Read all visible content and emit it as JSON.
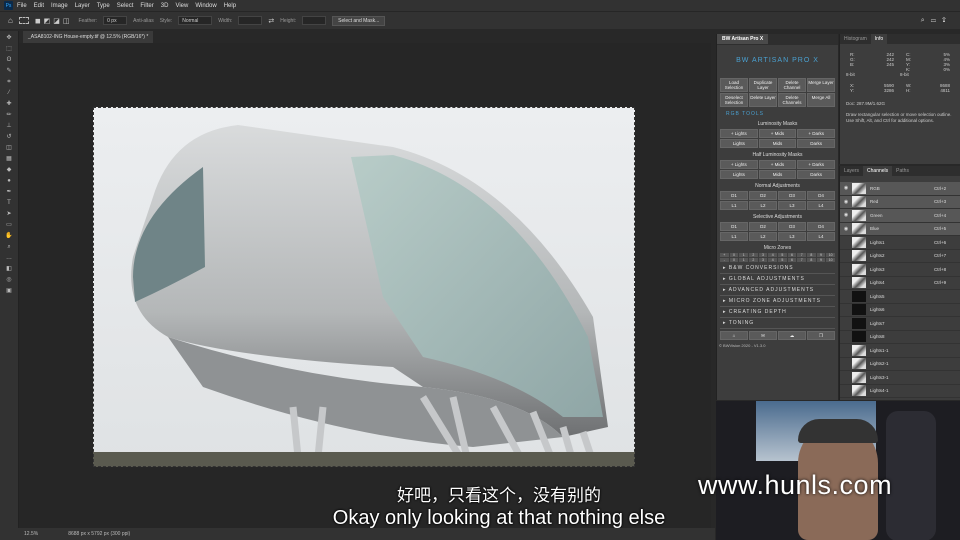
{
  "menubar": {
    "app_icon": "ps-logo",
    "items": [
      "File",
      "Edit",
      "Image",
      "Layer",
      "Type",
      "Select",
      "Filter",
      "3D",
      "View",
      "Window",
      "Help"
    ]
  },
  "options": {
    "feather_label": "Feather:",
    "feather_value": "0 px",
    "antialias": "Anti-alias",
    "style_label": "Style:",
    "style_value": "Normal",
    "width_label": "Width:",
    "height_label": "Height:",
    "select_mask": "Select and Mask..."
  },
  "document": {
    "tab": "_ASA8102-ING House-empty.tif @ 12.5% (RGB/16*) *",
    "zoom": "12.5%",
    "dims": "8688 px x 5792 px (300 ppi)"
  },
  "subtitles": {
    "zh": "好吧，只看这个，没有别的",
    "en": "Okay only looking at that nothing else"
  },
  "watermark": "www.hunls.com",
  "bw": {
    "title": "BW Artisan Pro X",
    "logo": "BW ARTISAN PRO X",
    "top_buttons": [
      "Load Selection",
      "Duplicate Layer",
      "Delete Channel",
      "Merge Layer",
      "Deselect Selection",
      "Delete Layer",
      "Delete Channels",
      "Merge All"
    ],
    "tools_label": "RGB TOOLS",
    "lum_title": "Luminosity Masks",
    "lum": [
      "+ Lights",
      "+ Mids",
      "+ Darks",
      "Lights",
      "Mids",
      "Darks"
    ],
    "half_title": "Half Luminosity Masks",
    "half": [
      "+ Lights",
      "+ Mids",
      "+ Darks",
      "Lights",
      "Mids",
      "Darks"
    ],
    "normal_title": "Normal Adjustments",
    "normal": [
      "D1",
      "D2",
      "D3",
      "D4",
      "L1",
      "L2",
      "L3",
      "L4"
    ],
    "selective_title": "Selective Adjustments",
    "selective": [
      "D1",
      "D2",
      "D3",
      "D4",
      "L1",
      "L2",
      "L3",
      "L4"
    ],
    "micro_title": "Micro Zones",
    "micro_row1": [
      "+",
      "0",
      "1",
      "2",
      "3",
      "4",
      "5",
      "6",
      "7",
      "8",
      "9",
      "10"
    ],
    "micro_row2": [
      "-",
      "0",
      "1",
      "2",
      "3",
      "4",
      "5",
      "6",
      "7",
      "8",
      "9",
      "10"
    ],
    "sections": [
      "B&W CONVERSIONS",
      "GLOBAL ADJUSTMENTS",
      "ADVANCED ADJUSTMENTS",
      "MICRO ZONE ADJUSTMENTS",
      "CREATING DEPTH",
      "TONING"
    ],
    "footer": "© BWVision 2020 - V1.3.0"
  },
  "info": {
    "tabs": [
      "Histogram",
      "Info"
    ],
    "rgb": [
      [
        "R:",
        "242"
      ],
      [
        "G:",
        "242"
      ],
      [
        "B:",
        "245"
      ]
    ],
    "cmyk": [
      [
        "C:",
        "5%"
      ],
      [
        "M:",
        "4%"
      ],
      [
        "Y:",
        "3%"
      ],
      [
        "K:",
        "0%"
      ]
    ],
    "bit1": "8-bit",
    "bit2": "8-bit",
    "xy": [
      [
        "X:",
        "5590"
      ],
      [
        "Y:",
        "3286"
      ]
    ],
    "wh": [
      [
        "W:",
        "8688"
      ],
      [
        "H:",
        "4811"
      ]
    ],
    "doc": "Doc: 287.9M/1.62G",
    "hint": "Draw rectangular selection or move selection outline. Use Shift, Alt, and Ctrl for additional options."
  },
  "channels": {
    "tabs": [
      "Layers",
      "Channels",
      "Paths"
    ],
    "items": [
      {
        "name": "RGB",
        "sc": "Ctrl+2",
        "vis": true
      },
      {
        "name": "Red",
        "sc": "Ctrl+3",
        "vis": true
      },
      {
        "name": "Green",
        "sc": "Ctrl+4",
        "vis": true
      },
      {
        "name": "Blue",
        "sc": "Ctrl+5",
        "vis": true
      },
      {
        "name": "Lights1",
        "sc": "Ctrl+6"
      },
      {
        "name": "Lights2",
        "sc": "Ctrl+7"
      },
      {
        "name": "Lights3",
        "sc": "Ctrl+8"
      },
      {
        "name": "Lights4",
        "sc": "Ctrl+9"
      },
      {
        "name": "Lights5",
        "sc": ""
      },
      {
        "name": "Lights6",
        "sc": ""
      },
      {
        "name": "Lights7",
        "sc": ""
      },
      {
        "name": "Lights8",
        "sc": ""
      },
      {
        "name": "Lights1-1",
        "sc": ""
      },
      {
        "name": "Lights2-1",
        "sc": ""
      },
      {
        "name": "Lights3-1",
        "sc": ""
      },
      {
        "name": "Lights4-1",
        "sc": ""
      }
    ]
  }
}
